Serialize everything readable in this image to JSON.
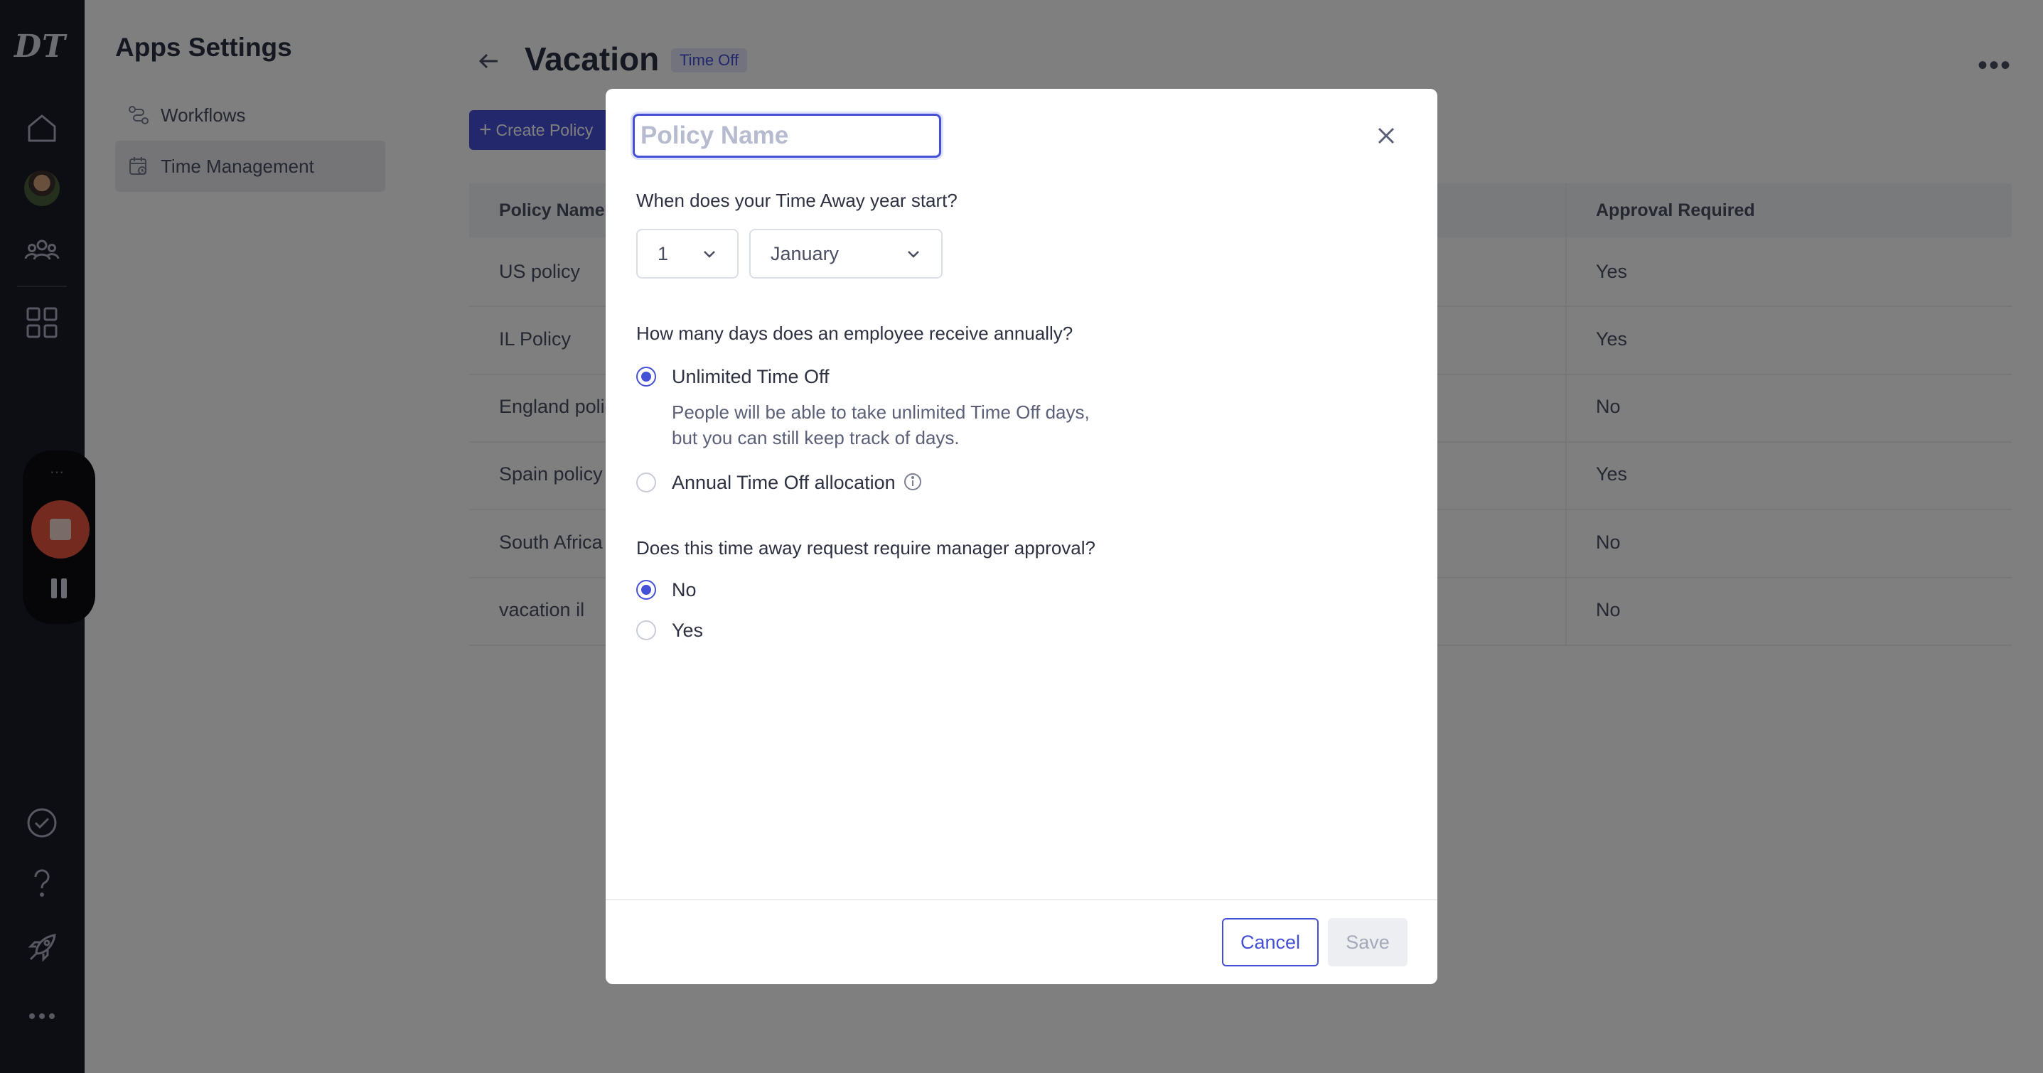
{
  "rail": {
    "logo": "DT",
    "icons": [
      "home-icon",
      "avatar",
      "people-icon",
      "apps-grid-icon",
      "check-circle-icon",
      "help-icon",
      "rocket-icon",
      "more-icon"
    ]
  },
  "settings": {
    "title": "Apps Settings",
    "items": [
      {
        "label": "Workflows",
        "icon": "workflow-icon",
        "active": false
      },
      {
        "label": "Time Management",
        "icon": "calendar-icon",
        "active": true
      }
    ]
  },
  "page": {
    "title": "Vacation",
    "badge": "Time Off",
    "create_button": "Create Policy"
  },
  "table": {
    "headers": [
      "Policy Name",
      "Approval Required"
    ],
    "rows": [
      {
        "name": "US policy",
        "approval": "Yes"
      },
      {
        "name": "IL Policy",
        "approval": "Yes"
      },
      {
        "name": "England polic",
        "approval": "No"
      },
      {
        "name": "Spain policy",
        "approval": "Yes"
      },
      {
        "name": "South Africa",
        "approval": "No"
      },
      {
        "name": "vacation il",
        "approval": "No"
      }
    ]
  },
  "modal": {
    "policy_name_value": "",
    "policy_name_placeholder": "Policy Name",
    "q_year_start": "When does your Time Away year start?",
    "day_select": "1",
    "month_select": "January",
    "q_days": "How many days does an employee receive annually?",
    "opt_unlimited": "Unlimited Time Off",
    "opt_unlimited_desc_1": "People will be able to take unlimited Time Off days,",
    "opt_unlimited_desc_2": "but you can still keep track of days.",
    "opt_annual": "Annual Time Off allocation",
    "q_approval": "Does this time away request require manager approval?",
    "opt_no": "No",
    "opt_yes": "Yes",
    "cancel": "Cancel",
    "save": "Save"
  },
  "colors": {
    "accent": "#4451d6",
    "rail_bg": "#1a1c26",
    "record": "#e8553d"
  }
}
